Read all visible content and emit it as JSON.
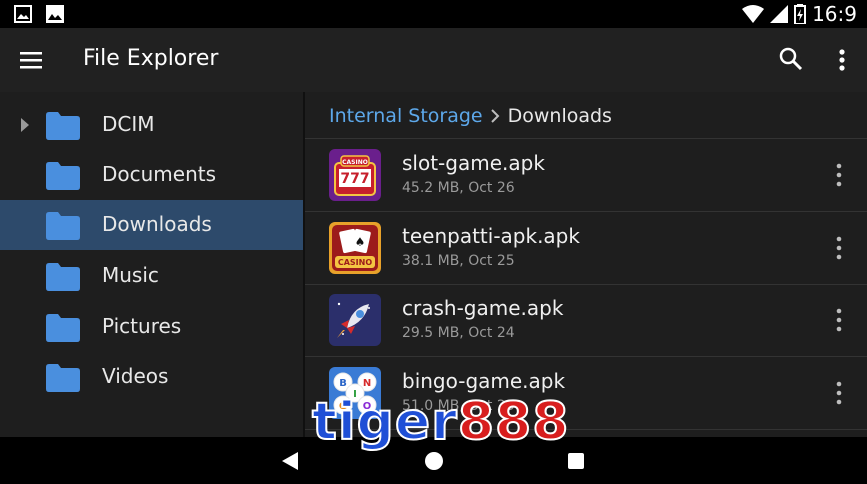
{
  "status_bar": {
    "time": "16:9",
    "icons": [
      "image-icon",
      "photo-icon",
      "wifi-icon",
      "signal-icon",
      "battery-icon"
    ]
  },
  "toolbar": {
    "title": "File Explorer",
    "menu_icon": "hamburger-menu-icon",
    "search_icon": "search-icon",
    "more_icon": "more-vert-icon"
  },
  "sidebar": {
    "items": [
      {
        "label": "DCIM",
        "expandable": true,
        "active": false
      },
      {
        "label": "Documents",
        "expandable": false,
        "active": false
      },
      {
        "label": "Downloads",
        "expandable": false,
        "active": true
      },
      {
        "label": "Music",
        "expandable": false,
        "active": false
      },
      {
        "label": "Pictures",
        "expandable": false,
        "active": false
      },
      {
        "label": "Videos",
        "expandable": false,
        "active": false
      }
    ]
  },
  "breadcrumb": {
    "root": "Internal Storage",
    "current": "Downloads"
  },
  "files": [
    {
      "name": "slot-game.apk",
      "meta": "45.2 MB, Oct 26",
      "thumb_text": "777",
      "thumb_label": "CASINO"
    },
    {
      "name": "teenpatti-apk.apk",
      "meta": "38.1 MB, Oct 25",
      "thumb_text": "",
      "thumb_label": "CASINO"
    },
    {
      "name": "crash-game.apk",
      "meta": "29.5 MB, Oct 24",
      "thumb_text": "",
      "thumb_label": ""
    },
    {
      "name": "bingo-game.apk",
      "meta": "51.0 MB, Oct 23",
      "thumb_text": "BINGO",
      "thumb_label": ""
    }
  ],
  "watermark": {
    "part1": "tiger",
    "part2": "888"
  },
  "colors": {
    "accent": "#5da8ea",
    "folder": "#4a8fde",
    "active_bg": "#2d4a6b",
    "toolbar_bg": "#212121"
  }
}
